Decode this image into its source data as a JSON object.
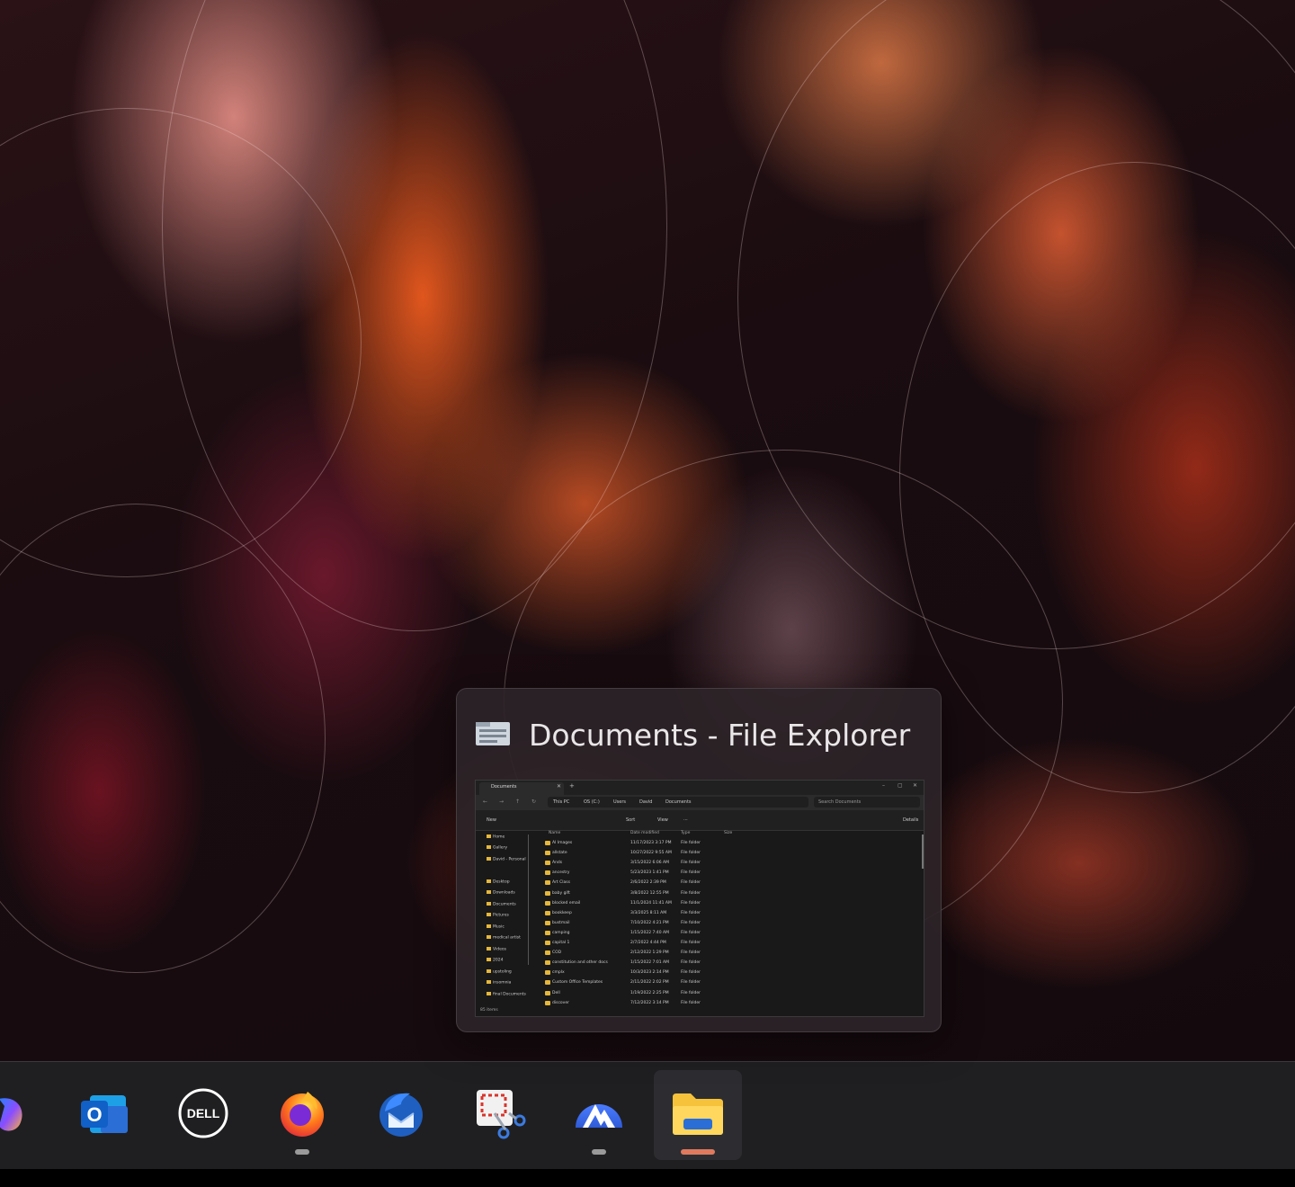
{
  "preview": {
    "title": "Documents - File Explorer",
    "thumbnail": {
      "tab_label": "Documents",
      "tab_close": "✕",
      "new_tab": "+",
      "window_controls": [
        "–",
        "▢",
        "✕"
      ],
      "breadcrumbs": [
        "This PC",
        "OS (C:)",
        "Users",
        "David",
        "Documents"
      ],
      "search_placeholder": "Search Documents",
      "commands": {
        "new": "New",
        "sort": "Sort",
        "view": "View",
        "more": "···",
        "details": "Details"
      },
      "sidebar": [
        "Home",
        "Gallery",
        "David - Personal",
        "Desktop",
        "Downloads",
        "Documents",
        "Pictures",
        "Music",
        "medical artist",
        "Videos",
        "2024",
        "upstoling",
        "insomnia",
        "final Documents"
      ],
      "columns": {
        "name": "Name",
        "date": "Date modified",
        "type": "Type",
        "size": "Size"
      },
      "files": [
        {
          "name": "AI Images",
          "date": "11/17/2023 3:17 PM",
          "type": "File folder"
        },
        {
          "name": "allstate",
          "date": "10/27/2022 9:55 AM",
          "type": "File folder"
        },
        {
          "name": "Ands",
          "date": "3/15/2022 6:06 AM",
          "type": "File folder"
        },
        {
          "name": "ancestry",
          "date": "5/23/2023 1:41 PM",
          "type": "File folder"
        },
        {
          "name": "Art Class",
          "date": "2/6/2022 2:39 PM",
          "type": "File folder"
        },
        {
          "name": "baby gift",
          "date": "3/8/2022 12:55 PM",
          "type": "File folder"
        },
        {
          "name": "blocked email",
          "date": "11/1/2024 11:41 AM",
          "type": "File folder"
        },
        {
          "name": "bookkeep",
          "date": "3/3/2025 8:11 AM",
          "type": "File folder"
        },
        {
          "name": "bustmail",
          "date": "7/10/2022 4:21 PM",
          "type": "File folder"
        },
        {
          "name": "camping",
          "date": "1/15/2022 7:40 AM",
          "type": "File folder"
        },
        {
          "name": "capital 1",
          "date": "2/7/2022 4:44 PM",
          "type": "File folder"
        },
        {
          "name": "COD",
          "date": "2/12/2022 1:29 PM",
          "type": "File folder"
        },
        {
          "name": "constitution and other docs",
          "date": "1/15/2022 7:01 AM",
          "type": "File folder"
        },
        {
          "name": "cmplx",
          "date": "10/3/2023 2:14 PM",
          "type": "File folder"
        },
        {
          "name": "Custom Office Templates",
          "date": "2/11/2022 2:02 PM",
          "type": "File folder"
        },
        {
          "name": "Dell",
          "date": "1/19/2022 2:25 PM",
          "type": "File folder"
        },
        {
          "name": "discover",
          "date": "7/12/2022 3:14 PM",
          "type": "File folder"
        }
      ],
      "status": "85 items"
    }
  },
  "taskbar": {
    "apps": [
      {
        "name": "Copilot",
        "icon": "copilot-icon"
      },
      {
        "name": "Outlook",
        "icon": "outlook-icon",
        "glyph": "O"
      },
      {
        "name": "Dell",
        "icon": "dell-icon",
        "glyph": "DELL"
      },
      {
        "name": "Firefox",
        "icon": "firefox-icon",
        "running": true
      },
      {
        "name": "Thunderbird",
        "icon": "thunderbird-icon"
      },
      {
        "name": "Snipping Tool",
        "icon": "snipping-tool-icon"
      },
      {
        "name": "NordVPN",
        "icon": "nordvpn-icon",
        "running": true
      },
      {
        "name": "File Explorer",
        "icon": "file-explorer-icon",
        "running": true,
        "active": true
      }
    ],
    "colors": {
      "bar": "#1f1f22",
      "indicator": "#9a9a9a",
      "active_indicator": "#e07a5f"
    }
  }
}
